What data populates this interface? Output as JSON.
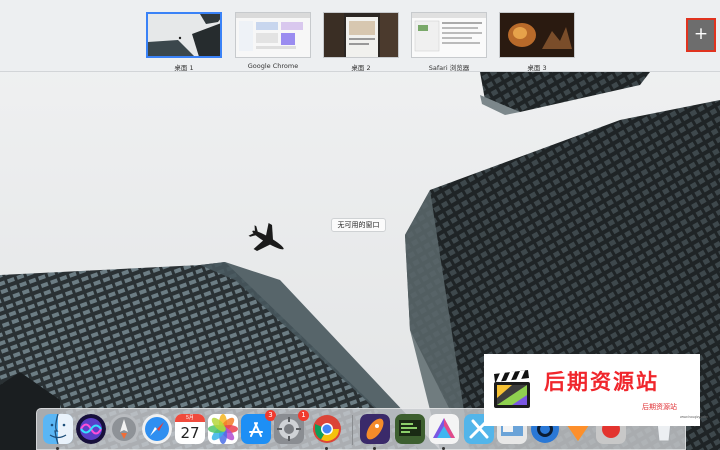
{
  "spaces": [
    {
      "label": "桌面 1",
      "active": true
    },
    {
      "label": "Google Chrome",
      "active": false
    },
    {
      "label": "桌面 2",
      "active": false
    },
    {
      "label": "Safari 浏览器",
      "active": false
    },
    {
      "label": "桌面 3",
      "active": false
    }
  ],
  "add_space": {
    "label": "+"
  },
  "desktop": {
    "no_windows_text": "无可用的窗口"
  },
  "dock": {
    "calendar": {
      "month": "5月",
      "day": "27"
    },
    "app_store_badge": "3",
    "system_prefs_badge": "1",
    "apps": [
      "finder-icon",
      "siri-icon",
      "launchpad-icon",
      "safari-icon",
      "calendar-icon",
      "photos-icon",
      "app-store-icon",
      "system-preferences-icon",
      "chrome-icon",
      "rocket-typist-icon",
      "coding-app-icon",
      "affinity-icon",
      "xcode-icon",
      "preview-icon",
      "quicktime-icon",
      "sketch-icon",
      "game-icon",
      "trash-icon"
    ]
  },
  "watermark": {
    "title": "后期资源站",
    "subtitle": "后期资源站",
    "url": "www.houqizy.com"
  },
  "colors": {
    "active_space": "#3a82f7",
    "highlight_box": "#e0331f",
    "badge": "#f03a2e",
    "watermark_text": "#f0262c"
  }
}
